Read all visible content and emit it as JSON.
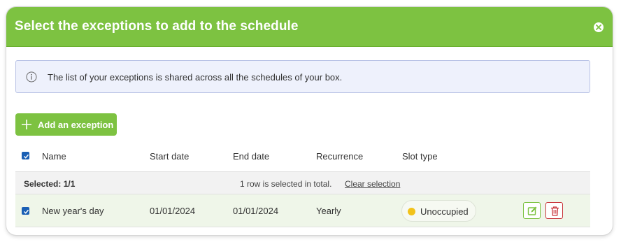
{
  "dialog": {
    "title": "Select the exceptions to add to the schedule",
    "close_icon": "close-icon"
  },
  "info": {
    "icon": "info-icon",
    "text": "The list of your exceptions is shared across all the schedules of your box."
  },
  "toolbar": {
    "add_icon": "plus-icon",
    "add_label": "Add an exception"
  },
  "table": {
    "select_all_checked": true,
    "columns": [
      "Name",
      "Start date",
      "End date",
      "Recurrence",
      "Slot type"
    ],
    "selection": {
      "count": "Selected: 1/1",
      "info": "1 row is selected in total.",
      "clear_label": "Clear selection"
    },
    "rows": [
      {
        "checked": true,
        "name": "New year's day",
        "start_date": "01/01/2024",
        "end_date": "01/01/2024",
        "recurrence": "Yearly",
        "slot_type": "Unoccupied",
        "slot_color": "#f2c21a",
        "actions": [
          "edit-icon",
          "trash-icon"
        ]
      }
    ]
  },
  "colors": {
    "accent": "#7dc241",
    "checkbox": "#1a5fb4",
    "danger": "#c9353b",
    "info_bg": "#eef1fc"
  }
}
